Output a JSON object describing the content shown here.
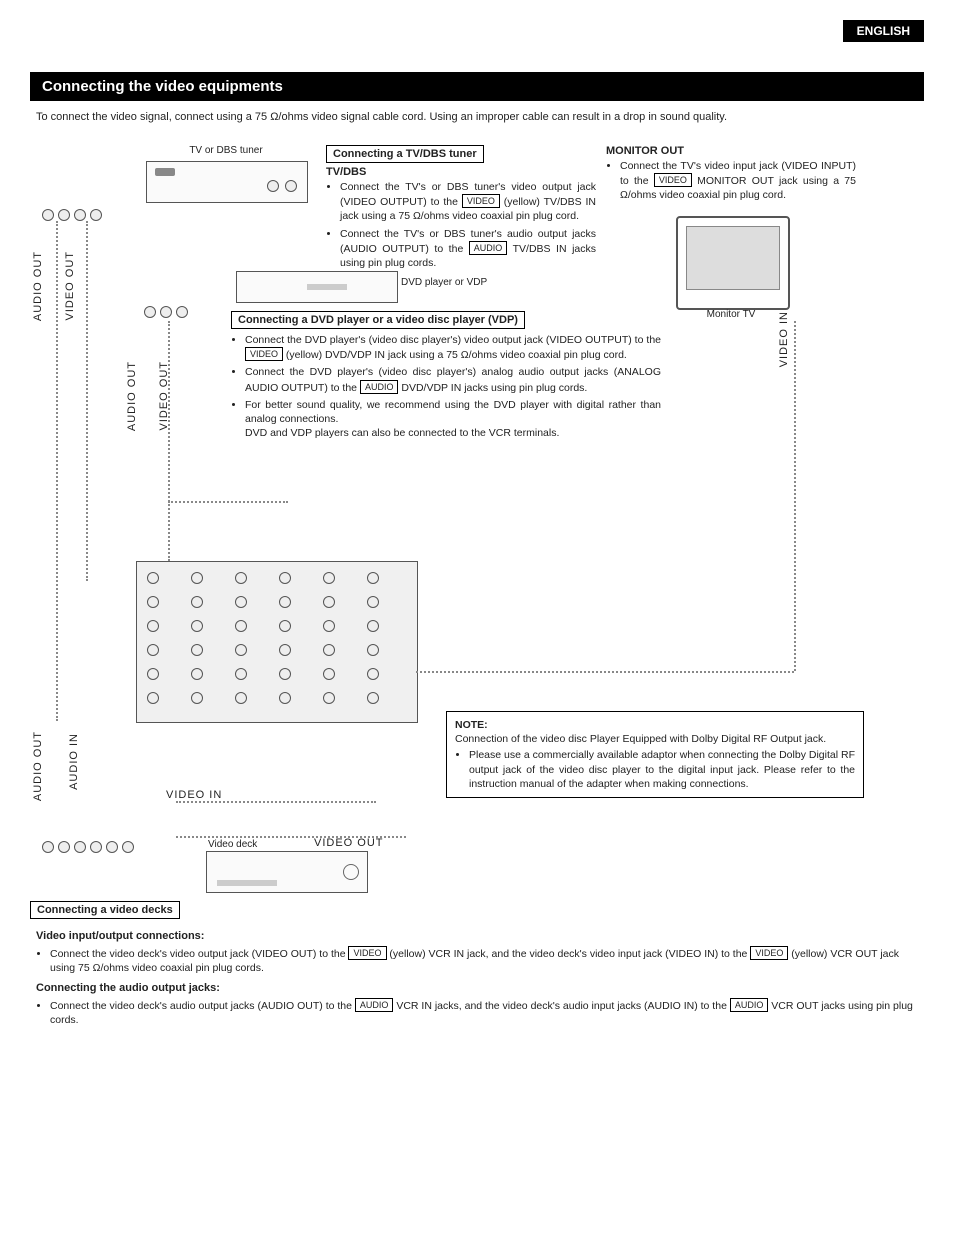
{
  "header": {
    "language": "ENGLISH"
  },
  "section": {
    "title": "Connecting the video equipments",
    "intro": "To connect the video signal, connect using a 75 Ω/ohms video signal cable cord. Using an improper cable can result in a drop in sound quality."
  },
  "labels": {
    "tuner": "TV or DBS tuner",
    "dvd": "DVD player or VDP",
    "monitor_tv": "Monitor TV",
    "video_deck": "Video deck",
    "audio_out": "AUDIO OUT",
    "video_out": "VIDEO OUT",
    "video_in": "VIDEO IN",
    "audio_in": "AUDIO IN"
  },
  "chips": {
    "video": "VIDEO",
    "audio": "AUDIO"
  },
  "tv_dbs": {
    "box_heading": "Connecting a TV/DBS tuner",
    "sub": "TV/DBS",
    "b1a": "Connect the TV's or DBS tuner's video output jack (VIDEO OUTPUT) to the ",
    "b1b": " (yellow) TV/DBS IN jack using a 75 Ω/ohms video coaxial pin plug cord.",
    "b2a": "Connect the TV's or DBS tuner's audio output jacks (AUDIO OUTPUT) to the ",
    "b2b": " TV/DBS IN jacks using pin plug cords."
  },
  "monitor_out": {
    "heading": "MONITOR OUT",
    "b1a": "Connect the TV's video input jack (VIDEO INPUT) to the ",
    "b1b": " MONITOR OUT jack using a 75 Ω/ohms video coaxial pin plug cord."
  },
  "dvd_section": {
    "box_heading": "Connecting a DVD player or a video disc player (VDP)",
    "b1a": "Connect the DVD player's (video disc player's) video output jack (VIDEO OUTPUT) to the ",
    "b1b": " (yellow) DVD/VDP IN jack using a 75 Ω/ohms video coaxial pin plug cord.",
    "b2a": "Connect the DVD player's (video disc player's) analog audio output jacks (ANALOG AUDIO OUTPUT) to the ",
    "b2b": " DVD/VDP IN jacks using pin plug cords.",
    "b3": "For better sound quality, we recommend using the DVD player with digital rather than analog connections.",
    "b3_extra": "DVD and VDP players can also be connected to the VCR terminals."
  },
  "note": {
    "title": "NOTE:",
    "line1": "Connection of the video disc Player Equipped with Dolby Digital RF Output jack.",
    "b1": "Please use a commercially available adaptor when connecting the Dolby Digital RF output jack of the video disc player to the digital input jack. Please refer to the instruction manual of the adapter when making connections."
  },
  "video_deck": {
    "box_heading": "Connecting a video decks",
    "sub1": "Video input/output connections:",
    "b1a": "Connect the video deck's video output jack (VIDEO OUT) to the ",
    "b1b": " (yellow) VCR IN jack, and the video deck's video input jack (VIDEO IN) to the ",
    "b1c": " (yellow) VCR OUT jack using 75 Ω/ohms video coaxial pin plug cords.",
    "sub2": "Connecting the audio output jacks:",
    "b2a": "Connect the video deck's audio output jacks (AUDIO OUT) to the ",
    "b2b": " VCR IN jacks, and the video deck's audio input jacks (AUDIO IN) to the ",
    "b2c": " VCR OUT jacks using pin plug cords."
  }
}
